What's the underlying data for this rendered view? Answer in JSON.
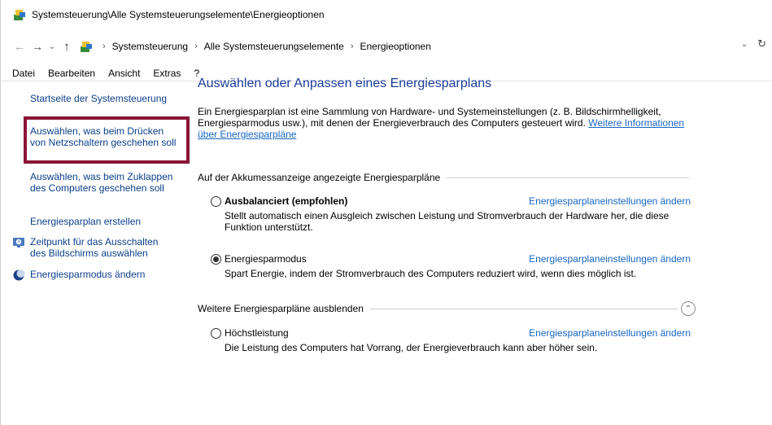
{
  "titlebar": {
    "title": "Systemsteuerung\\Alle Systemsteuerungselemente\\Energieoptionen",
    "icon": "control-panel-icon"
  },
  "address": {
    "crumbs": [
      "Systemsteuerung",
      "Alle Systemsteuerungselemente",
      "Energieoptionen"
    ],
    "back": "←",
    "forward": "→",
    "recent": "⌄",
    "up": "↑",
    "dropdown": "⌄",
    "refresh": "↻",
    "separator": "›"
  },
  "menu": [
    "Datei",
    "Bearbeiten",
    "Ansicht",
    "Extras",
    "?"
  ],
  "sidebar": {
    "home": "Startseite der Systemsteuerung",
    "items": [
      "Auswählen, was beim Drücken von Netzschaltern geschehen soll",
      "Auswählen, was beim Zuklappen des Computers geschehen soll",
      "Energiesparplan erstellen",
      "Zeitpunkt für das Ausschalten des Bildschirms auswählen",
      "Energiesparmodus ändern"
    ],
    "highlight_color": "#8a1538"
  },
  "main": {
    "title": "Auswählen oder Anpassen eines Energiesparplans",
    "intro": "Ein Energiesparplan ist eine Sammlung von Hardware- und Systemeinstellungen (z. B. Bildschirmhelligkeit, Energiesparmodus usw.), mit denen der Energieverbrauch des Computers gesteuert wird.",
    "intro_link": "Weitere Informationen über Energiesparpläne",
    "section1": "Auf der Akkumessanzeige angezeigte Energiesparpläne",
    "section2": "Weitere Energiesparpläne ausblenden",
    "collapse": "⌃",
    "plans": [
      {
        "name": "Ausbalanciert (empfohlen)",
        "selected": false,
        "link": "Energiesparplaneinstellungen ändern",
        "desc": "Stellt automatisch einen Ausgleich zwischen Leistung und Stromverbrauch der Hardware her, die diese Funktion unterstützt."
      },
      {
        "name": "Energiesparmodus",
        "selected": true,
        "link": "Energiesparplaneinstellungen ändern",
        "desc": "Spart Energie, indem der Stromverbrauch des Computers reduziert wird, wenn dies möglich ist."
      },
      {
        "name": "Höchstleistung",
        "selected": false,
        "link": "Energiesparplaneinstellungen ändern",
        "desc": "Die Leistung des Computers hat Vorrang, der Energieverbrauch kann aber höher sein."
      }
    ]
  },
  "colors": {
    "link": "#1766c2",
    "heading": "#1a3c9a",
    "sidebar_link": "#0a3f8a"
  }
}
